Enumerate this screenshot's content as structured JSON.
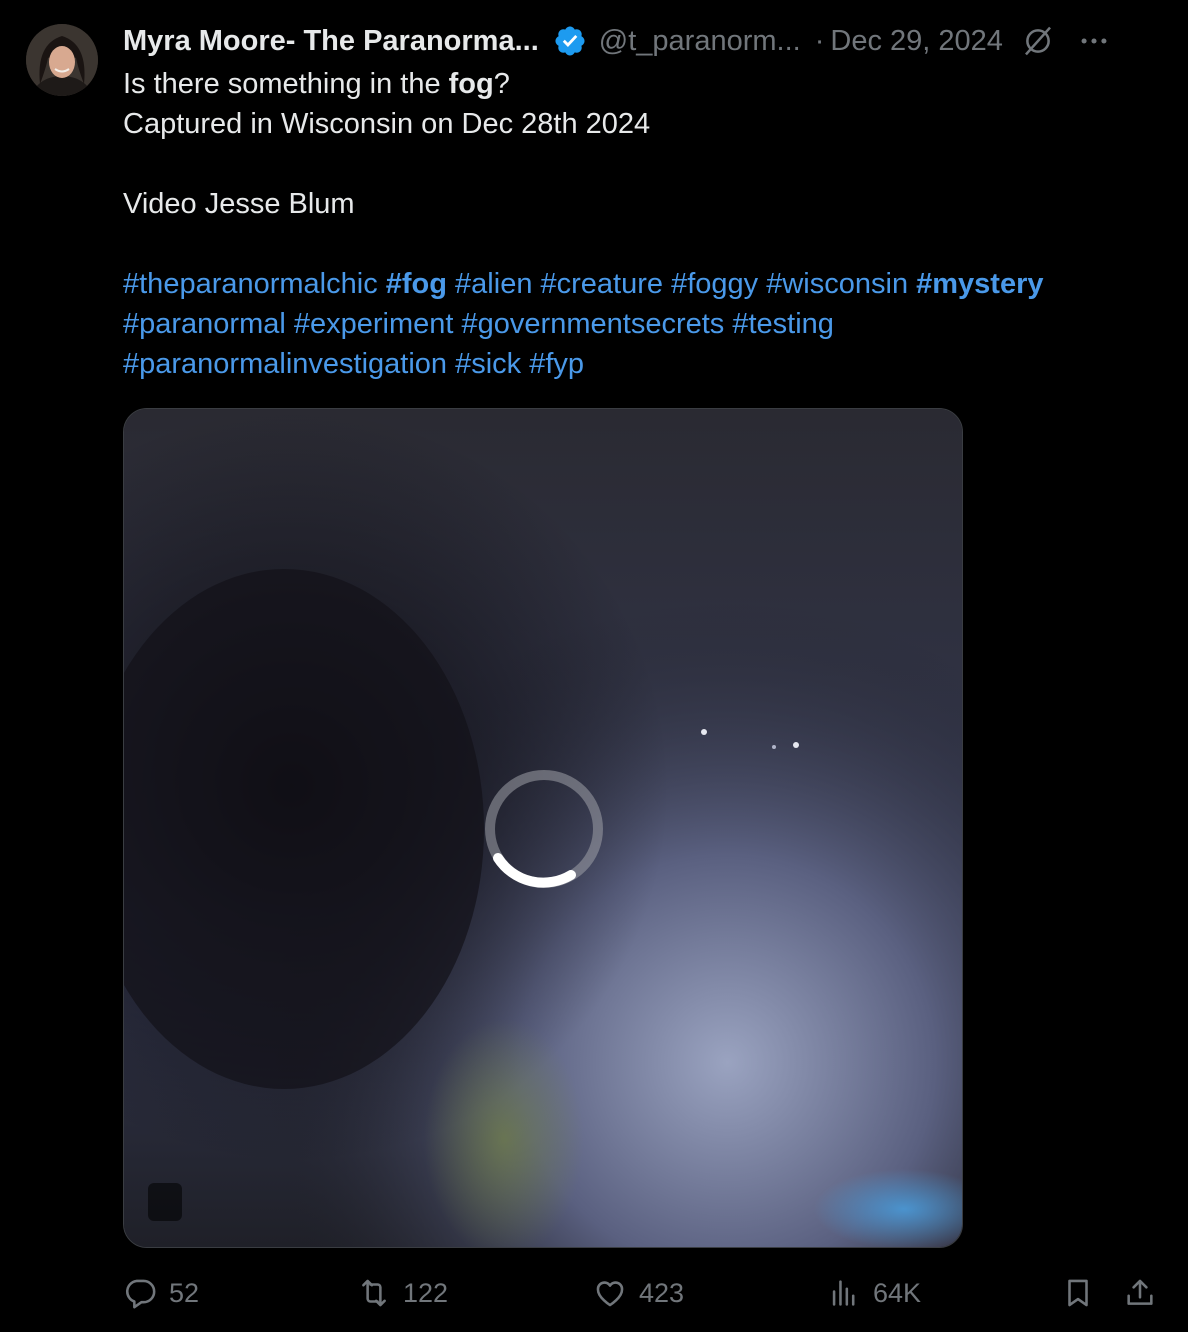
{
  "post": {
    "author": {
      "display_name": "Myra Moore- The Paranorma...",
      "handle": "@t_paranorm...",
      "verified": true,
      "avatar_icon": "profile-photo"
    },
    "separator": "·",
    "date": "Dec 29, 2024",
    "text": {
      "line1_pre": "Is there something in the ",
      "line1_bold": "fog",
      "line1_post": "?",
      "line2": "Captured in Wisconsin on Dec 28th 2024",
      "line3": "Video Jesse Blum"
    },
    "hashtags": [
      {
        "text": "#theparanormalchic",
        "bold": false
      },
      {
        "text": "#fog",
        "bold": true
      },
      {
        "text": "#alien",
        "bold": false
      },
      {
        "text": "#creature",
        "bold": false
      },
      {
        "text": "#foggy",
        "bold": false
      },
      {
        "text": "#wisconsin",
        "bold": false
      },
      {
        "text": "#mystery",
        "bold": true
      },
      {
        "text": "#paranormal",
        "bold": false
      },
      {
        "text": "#experiment",
        "bold": false
      },
      {
        "text": "#governmentsecrets",
        "bold": false
      },
      {
        "text": "#testing",
        "bold": false
      },
      {
        "text": "#paranormalinvestigation",
        "bold": false
      },
      {
        "text": "#sick",
        "bold": false
      },
      {
        "text": "#fyp",
        "bold": false
      }
    ],
    "media": {
      "type": "video",
      "state": "loading"
    },
    "actions": {
      "replies": "52",
      "reposts": "122",
      "likes": "423",
      "views": "64K"
    }
  },
  "colors": {
    "background": "#000000",
    "text": "#e7e9ea",
    "muted": "#71767b",
    "link": "#4a99e9",
    "verified": "#1d9bf0"
  }
}
